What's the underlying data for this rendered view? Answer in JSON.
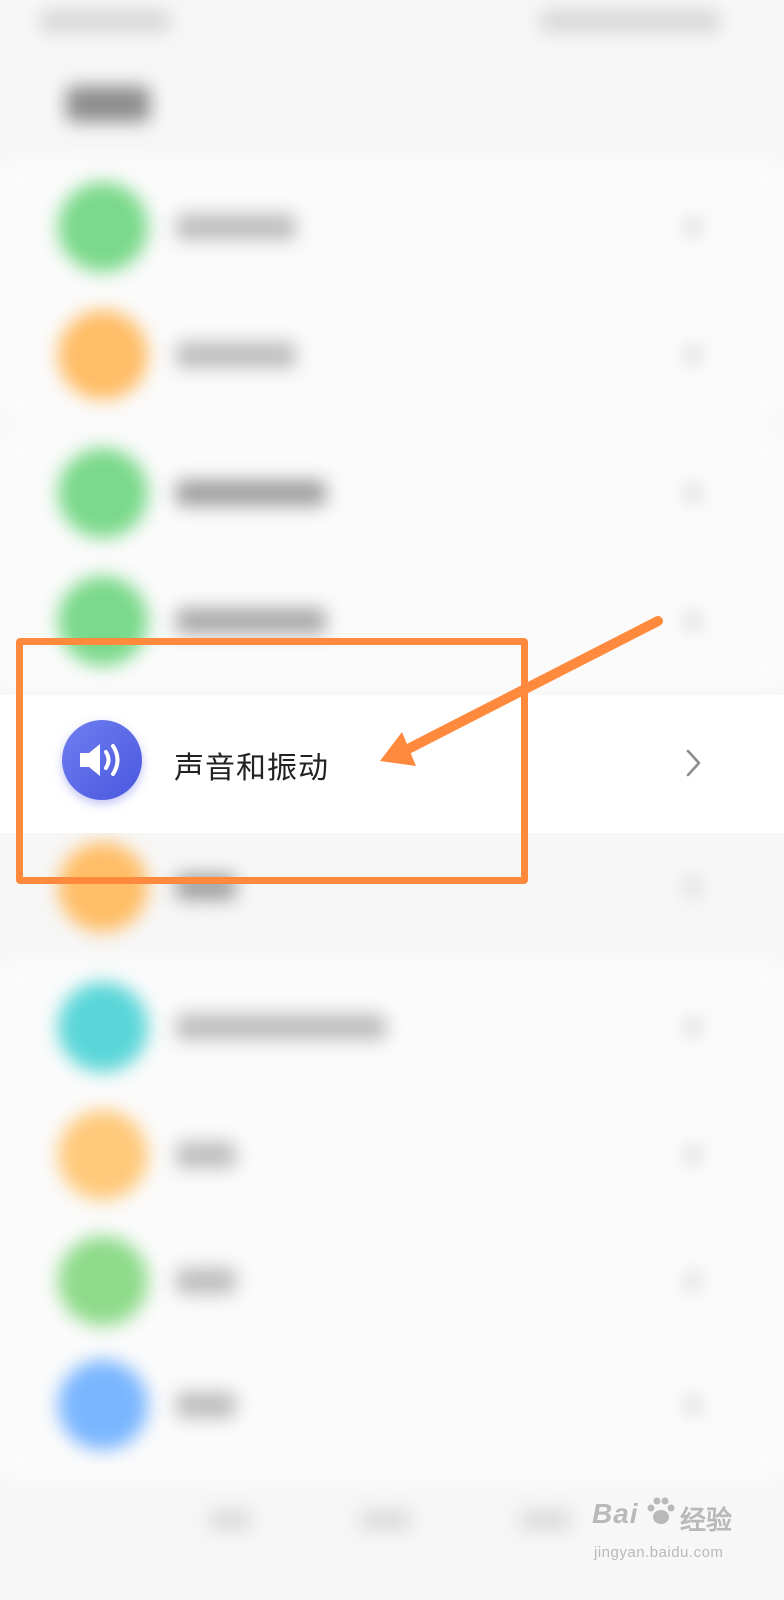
{
  "settings": {
    "highlighted_item": {
      "label": "声音和振动",
      "icon": "speaker-icon",
      "icon_gradient": [
        "#6f7ff0",
        "#4a57df"
      ],
      "chevron_icon": "chevron-right-icon"
    },
    "blurred_icon_colors": [
      "#7ad98a",
      "#ffbd66",
      "#7ad98a",
      "#7ad98a",
      "#ffbd66",
      "#5ad6d8",
      "#ffc97a",
      "#8edb8a",
      "#7ab6ff"
    ]
  },
  "annotation": {
    "color": "#ff8a3d",
    "shapes": [
      "highlight-box",
      "pointer-arrow"
    ]
  },
  "watermark": {
    "brand": "Bai",
    "paw_icon": "paw-icon",
    "brand_suffix": "经验",
    "url": "jingyan.baidu.com"
  }
}
